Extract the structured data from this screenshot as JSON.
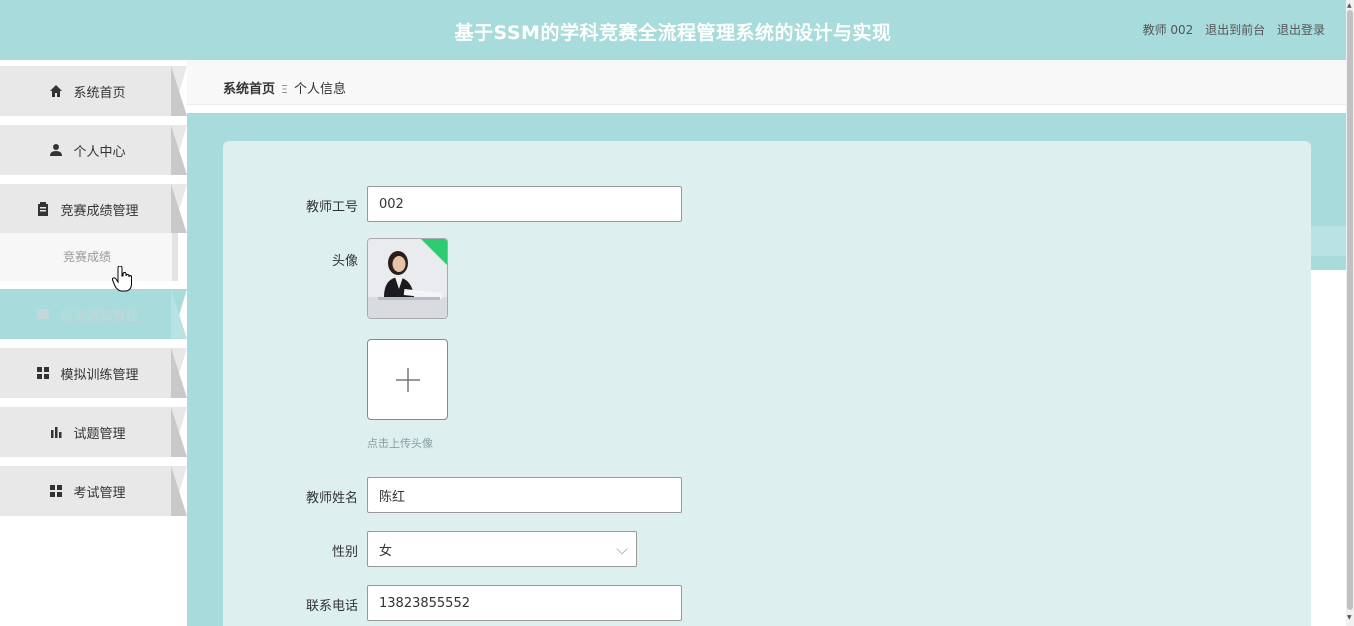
{
  "header": {
    "title": "基于SSM的学科竞赛全流程管理系统的设计与实现",
    "user": "教师 002",
    "back_to_front": "退出到前台",
    "logout": "退出登录"
  },
  "sidebar": {
    "items": [
      {
        "label": "系统首页",
        "icon": "home-icon"
      },
      {
        "label": "个人中心",
        "icon": "user-icon"
      },
      {
        "label": "竞赛成绩管理",
        "icon": "clipboard-icon"
      },
      {
        "label": "规则通知管理",
        "icon": "book-icon"
      },
      {
        "label": "模拟训练管理",
        "icon": "grid-icon"
      },
      {
        "label": "试题管理",
        "icon": "bar-chart-icon"
      },
      {
        "label": "考试管理",
        "icon": "grid-icon"
      }
    ],
    "submenu_label": "竞赛成绩"
  },
  "breadcrumb": {
    "home": "系统首页",
    "separator": "Ξ",
    "current": "个人信息"
  },
  "form": {
    "teacher_id_label": "教师工号",
    "teacher_id_value": "002",
    "avatar_label": "头像",
    "upload_hint": "点击上传头像",
    "teacher_name_label": "教师姓名",
    "teacher_name_value": "陈红",
    "gender_label": "性别",
    "gender_value": "女",
    "phone_label": "联系电话",
    "phone_value": "13823855552"
  },
  "colors": {
    "accent": "#a8dcdc",
    "card": "#ddf0ef",
    "menu_bg": "#e8e8e8"
  }
}
